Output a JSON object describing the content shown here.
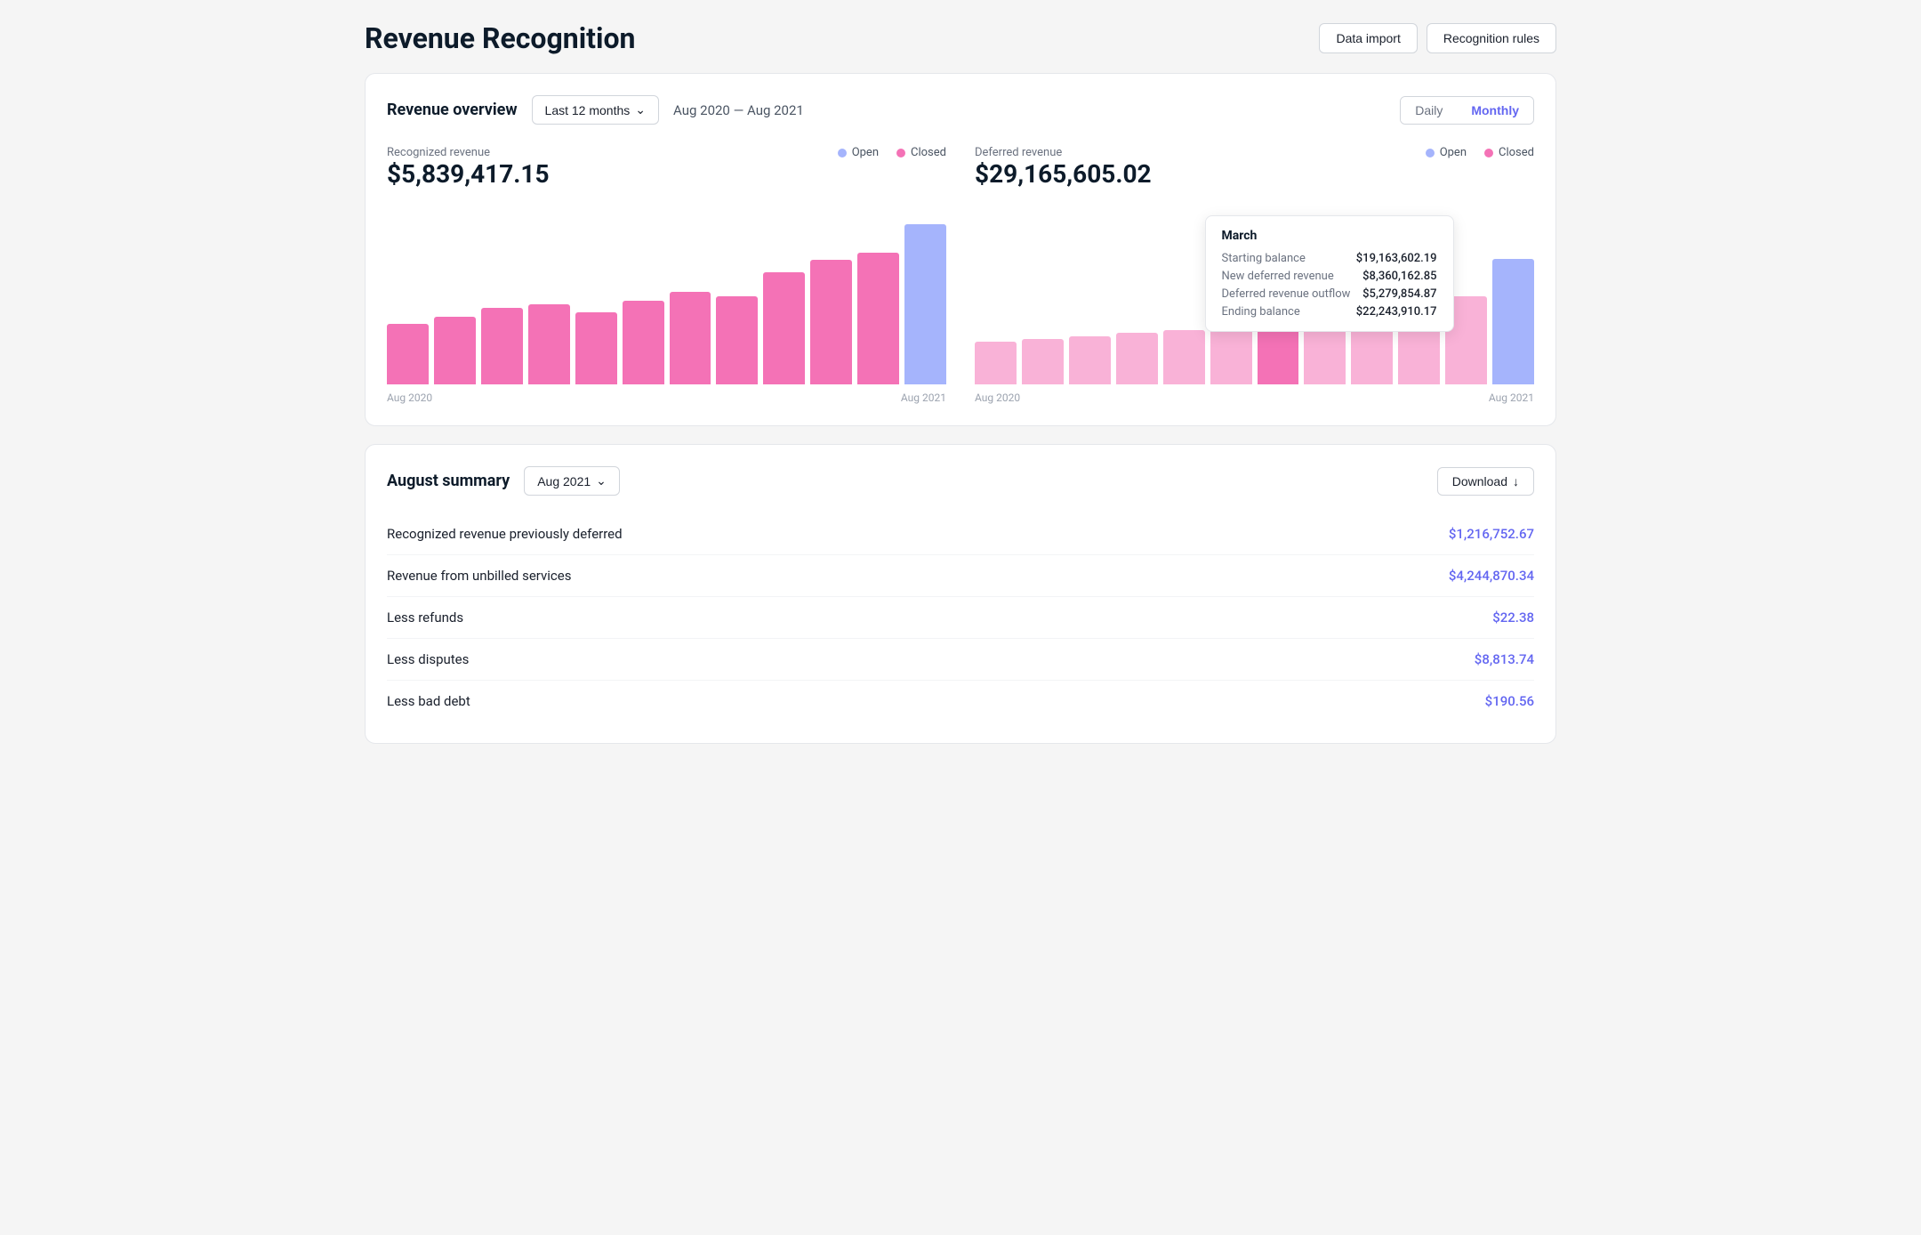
{
  "page": {
    "title": "Revenue Recognition",
    "header_buttons": [
      {
        "id": "data-import",
        "label": "Data import"
      },
      {
        "id": "recognition-rules",
        "label": "Recognition rules"
      }
    ]
  },
  "overview": {
    "title": "Revenue overview",
    "date_filter": "Last 12 months",
    "date_range": "Aug 2020 — Aug 2021",
    "toggle": {
      "daily": "Daily",
      "monthly": "Monthly",
      "active": "monthly"
    },
    "recognized": {
      "label": "Recognized revenue",
      "value": "$5,839,417.15",
      "legend_open": "Open",
      "legend_closed": "Closed"
    },
    "deferred": {
      "label": "Deferred revenue",
      "value": "$29,165,605.02",
      "legend_open": "Open",
      "legend_closed": "Closed"
    },
    "x_label_left": "Aug 2020",
    "x_label_right": "Aug 2021"
  },
  "tooltip": {
    "title": "March",
    "rows": [
      {
        "label": "Starting balance",
        "value": "$19,163,602.19"
      },
      {
        "label": "New deferred revenue",
        "value": "$8,360,162.85"
      },
      {
        "label": "Deferred revenue outflow",
        "value": "$5,279,854.87"
      },
      {
        "label": "Ending balance",
        "value": "$22,243,910.17"
      }
    ]
  },
  "summary": {
    "title": "August summary",
    "month_filter": "Aug 2021",
    "download_label": "Download",
    "rows": [
      {
        "label": "Recognized revenue previously deferred",
        "value": "$1,216,752.67"
      },
      {
        "label": "Revenue from unbilled services",
        "value": "$4,244,870.34"
      },
      {
        "label": "Less refunds",
        "value": "$22.38"
      },
      {
        "label": "Less disputes",
        "value": "$8,813.74"
      },
      {
        "label": "Less bad debt",
        "value": "$190.56"
      }
    ]
  },
  "charts": {
    "recognized_bars": [
      38,
      42,
      48,
      50,
      45,
      52,
      58,
      55,
      70,
      78,
      82,
      100
    ],
    "deferred_open_bars": [
      18,
      20,
      22,
      24,
      26,
      28,
      30,
      32,
      34,
      36,
      40,
      45
    ],
    "deferred_closed_bars": [
      30,
      32,
      34,
      36,
      38,
      40,
      50,
      52,
      54,
      58,
      62,
      88
    ]
  }
}
